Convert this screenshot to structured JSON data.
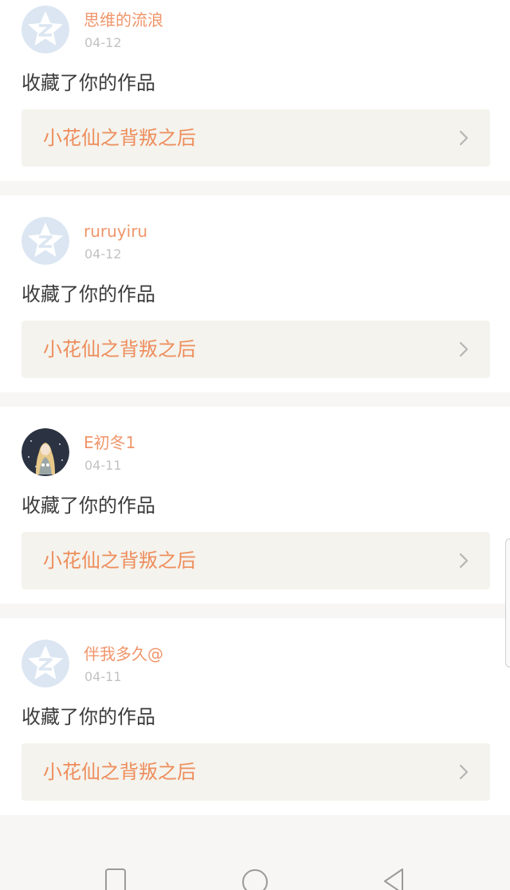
{
  "notifications": [
    {
      "username": "思维的流浪",
      "date": "04-12",
      "action": "收藏了你的作品",
      "work_title": "小花仙之背叛之后",
      "avatar": "default-qzone-star-avatar"
    },
    {
      "username": "ruruyiru",
      "date": "04-12",
      "action": "收藏了你的作品",
      "work_title": "小花仙之背叛之后",
      "avatar": "default-qzone-star-avatar"
    },
    {
      "username": "E初冬1",
      "date": "04-11",
      "action": "收藏了你的作品",
      "work_title": "小花仙之背叛之后",
      "avatar": "anime-girl-photo-avatar"
    },
    {
      "username": "伴我多久@",
      "date": "04-11",
      "action": "收藏了你的作品",
      "work_title": "小花仙之背叛之后",
      "avatar": "default-qzone-star-avatar"
    }
  ],
  "navbar": {
    "recent_icon": "square-recent-apps-icon",
    "home_icon": "circle-home-icon",
    "back_icon": "triangle-back-icon"
  },
  "colors": {
    "username": "#f0956a",
    "work_title": "#ee8d5c",
    "work_bg": "#f4f3ed",
    "default_avatar": "#dbe6f2"
  }
}
